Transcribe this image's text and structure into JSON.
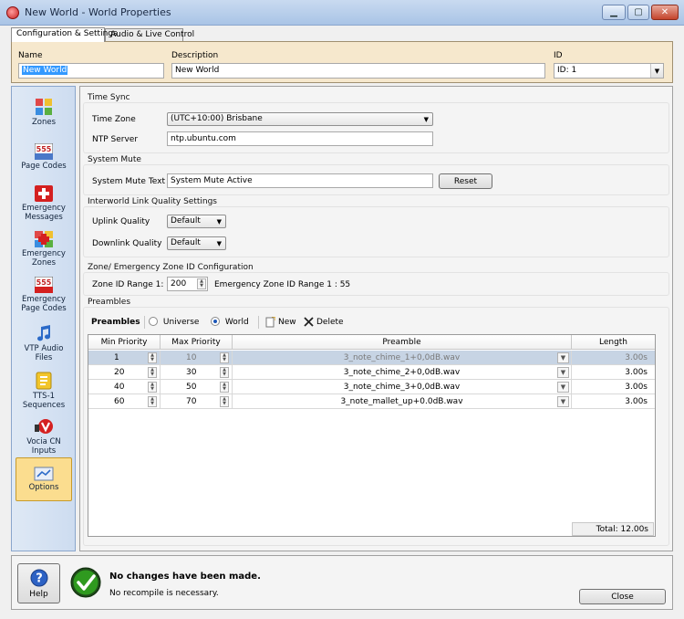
{
  "window": {
    "title": "New World - World Properties"
  },
  "tabs": [
    {
      "label": "Configuration & Settings",
      "active": true
    },
    {
      "label": "Audio & Live Control",
      "active": false
    }
  ],
  "header": {
    "name_label": "Name",
    "name_value": "New World",
    "description_label": "Description",
    "description_value": "New World",
    "id_label": "ID",
    "id_value": "ID: 1"
  },
  "sidebar": {
    "items": [
      {
        "label": "Zones",
        "icon": "zones-icon"
      },
      {
        "label": "Page Codes",
        "icon": "page-codes-icon"
      },
      {
        "label": "Emergency Messages",
        "icon": "emergency-messages-icon"
      },
      {
        "label": "Emergency Zones",
        "icon": "emergency-zones-icon"
      },
      {
        "label": "Emergency Page Codes",
        "icon": "emergency-page-codes-icon"
      },
      {
        "label": "VTP Audio Files",
        "icon": "music-note-icon"
      },
      {
        "label": "TTS-1 Sequences",
        "icon": "tts-icon"
      },
      {
        "label": "Vocia CN Inputs",
        "icon": "vocia-cn-icon"
      },
      {
        "label": "Options",
        "icon": "options-icon",
        "active": true
      }
    ],
    "icon_badge_text": "555"
  },
  "time_sync": {
    "title": "Time Sync",
    "time_zone_label": "Time Zone",
    "time_zone_value": "(UTC+10:00) Brisbane",
    "ntp_label": "NTP Server",
    "ntp_value": "ntp.ubuntu.com"
  },
  "system_mute": {
    "title": "System Mute",
    "text_label": "System Mute Text",
    "text_value": "System Mute Active",
    "reset_label": "Reset"
  },
  "link_quality": {
    "title": "Interworld Link Quality Settings",
    "uplink_label": "Uplink Quality",
    "uplink_value": "Default",
    "downlink_label": "Downlink Quality",
    "downlink_value": "Default"
  },
  "zone_id": {
    "title": "Zone/ Emergency Zone ID Configuration",
    "range_label": "Zone ID Range 1:",
    "range_value": "200",
    "emergency_range_text": "Emergency Zone ID Range 1 : 55"
  },
  "preambles": {
    "title": "Preambles",
    "toolbar_label": "Preambles",
    "radio_universe": "Universe",
    "radio_world": "World",
    "selected_scope": "World",
    "new_label": "New",
    "delete_label": "Delete",
    "columns": [
      "Min Priority",
      "Max Priority",
      "Preamble",
      "Length"
    ],
    "rows": [
      {
        "min": "1",
        "max": "10",
        "preamble": "3_note_chime_1+0,0dB.wav",
        "length": "3.00s",
        "selected": true
      },
      {
        "min": "20",
        "max": "30",
        "preamble": "3_note_chime_2+0,0dB.wav",
        "length": "3.00s",
        "selected": false
      },
      {
        "min": "40",
        "max": "50",
        "preamble": "3_note_chime_3+0,0dB.wav",
        "length": "3.00s",
        "selected": false
      },
      {
        "min": "60",
        "max": "70",
        "preamble": "3_note_mallet_up+0.0dB.wav",
        "length": "3.00s",
        "selected": false
      }
    ],
    "total": "Total: 12.00s"
  },
  "footer": {
    "help_label": "Help",
    "status_title": "No changes have been made.",
    "status_detail": "No recompile is necessary.",
    "close_label": "Close"
  },
  "colors": {
    "header_panel": "#f6e8cd",
    "sidebar_active": "#fbdd8f",
    "selected_row": "#c7d4e4",
    "check_green": "#2f9a1f"
  }
}
